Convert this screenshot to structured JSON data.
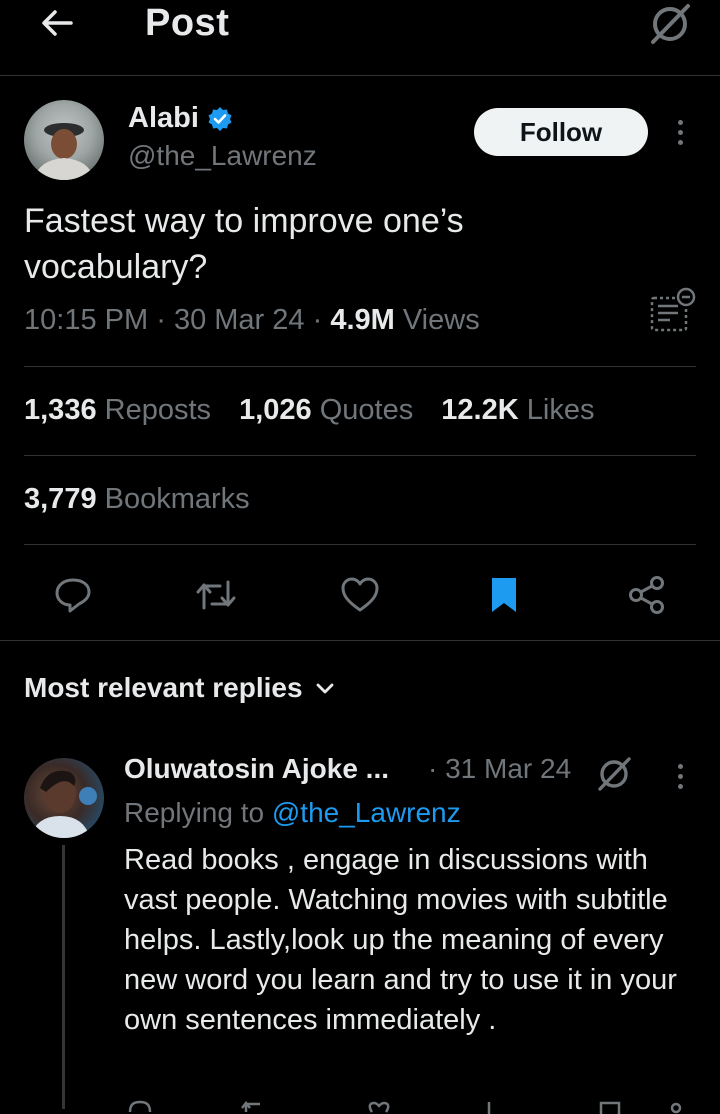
{
  "header": {
    "title": "Post"
  },
  "post": {
    "author_name": "Alabi",
    "author_handle": "@the_Lawrenz",
    "follow_label": "Follow",
    "text": "Fastest way to improve one’s vocabulary?",
    "time": "10:15 PM",
    "date": "30 Mar 24",
    "views_count": "4.9M",
    "views_label": "Views",
    "separator": "·"
  },
  "stats": {
    "reposts_count": "1,336",
    "reposts_label": "Reposts",
    "quotes_count": "1,026",
    "quotes_label": "Quotes",
    "likes_count": "12.2K",
    "likes_label": "Likes",
    "bookmarks_count": "3,779",
    "bookmarks_label": "Bookmarks"
  },
  "replies_section": {
    "label": "Most relevant replies"
  },
  "reply": {
    "author_name": "Oluwatosin Ajoke ...",
    "date": "· 31 Mar 24",
    "replying_prefix": "Replying to",
    "replying_handle": "@the_Lawrenz",
    "text": "Read books , engage in discussions with vast people. Watching movies with subtitle helps. Lastly,look up the meaning of every new word you learn and try to use it in your own sentences immediately ."
  },
  "colors": {
    "background": "#000000",
    "text_primary": "#e7e9ea",
    "text_secondary": "#71767b",
    "accent": "#1d9bf0",
    "divider": "#2f3336"
  },
  "icons": [
    "back-arrow-icon",
    "grok-icon",
    "verified-badge-icon",
    "more-icon",
    "translate-icon",
    "reply-icon",
    "repost-icon",
    "like-icon",
    "bookmark-icon",
    "share-icon",
    "chevron-down-icon"
  ]
}
